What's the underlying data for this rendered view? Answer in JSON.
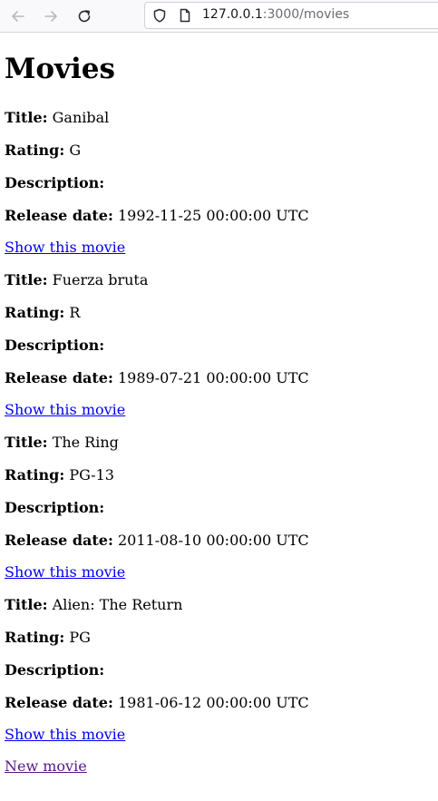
{
  "browser": {
    "url_host": "127.0.0.1",
    "url_path": ":3000/movies",
    "icons": [
      "back-arrow-icon",
      "forward-arrow-icon",
      "reload-icon",
      "shield-icon",
      "page-icon"
    ]
  },
  "page": {
    "heading": "Movies",
    "labels": {
      "title": "Title:",
      "rating": "Rating:",
      "description": "Description:",
      "release_date": "Release date:"
    },
    "show_link_label": "Show this movie",
    "new_link_label": "New movie",
    "link_color": "#0000ee",
    "visited_link_color": "#551a8b"
  },
  "movies": [
    {
      "title": "Ganibal",
      "rating": "G",
      "description": "",
      "release_date": "1992-11-25 00:00:00 UTC"
    },
    {
      "title": "Fuerza bruta",
      "rating": "R",
      "description": "",
      "release_date": "1989-07-21 00:00:00 UTC"
    },
    {
      "title": "The Ring",
      "rating": "PG-13",
      "description": "",
      "release_date": "2011-08-10 00:00:00 UTC"
    },
    {
      "title": "Alien: The Return",
      "rating": "PG",
      "description": "",
      "release_date": "1981-06-12 00:00:00 UTC"
    }
  ]
}
